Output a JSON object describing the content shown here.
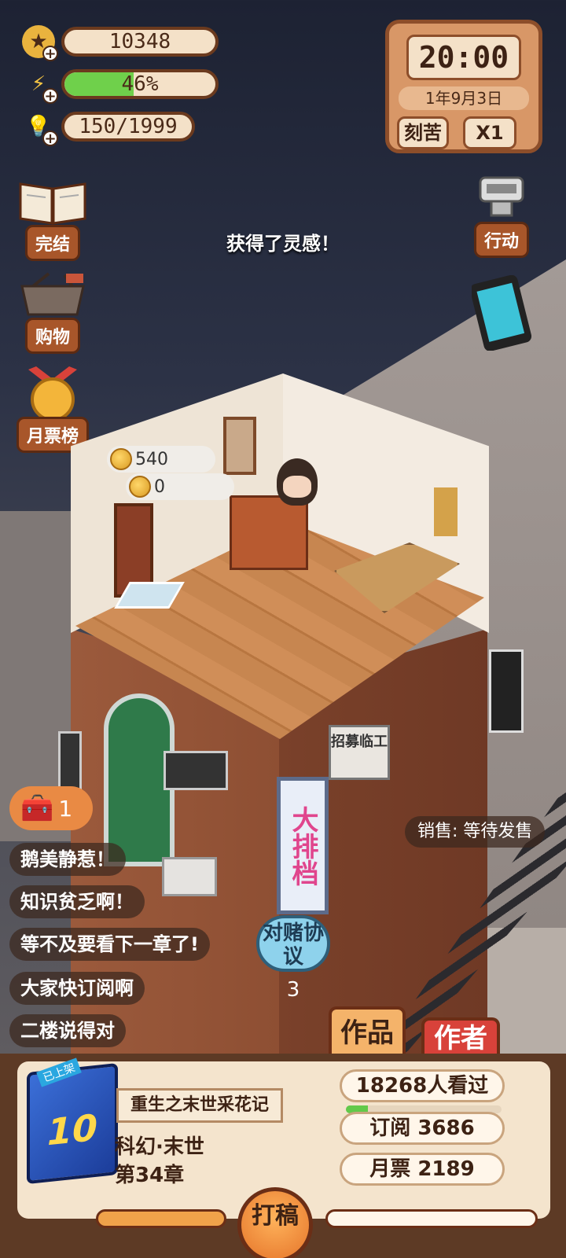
{
  "resources": {
    "coins": "10348",
    "energy_percent": 46,
    "energy_text": "46%",
    "inspiration": "150/1999"
  },
  "clock": {
    "time": "20:00",
    "date": "1年9月3日",
    "mode_button": "刻苦",
    "speed_button": "X1"
  },
  "left_menu": [
    {
      "label": "完结",
      "icon": "open-book-icon"
    },
    {
      "label": "购物",
      "icon": "shopping-basket-icon"
    },
    {
      "label": "月票榜",
      "icon": "medal-icon"
    }
  ],
  "right_menu": {
    "action_label": "行动",
    "action_icon": "typewriter-icon",
    "phone_icon": "phone-icon"
  },
  "toast": "获得了灵感！",
  "room": {
    "bubble_1": "540",
    "bubble_2": "0"
  },
  "signs": {
    "big_sign": "大排档",
    "recruit": "招募临工"
  },
  "chest_count": "1",
  "comments": [
    "鹅美静惹！",
    "知识贫乏啊！",
    "等不及要看下一章了!",
    "大家快订阅啊",
    "二楼说得对"
  ],
  "sales_status": "销售: 等待发售",
  "gamble": {
    "label": "对赌协议",
    "count": "3"
  },
  "tabs": {
    "works": "作品",
    "author": "作者"
  },
  "novel": {
    "cover_number": "10",
    "cover_tag": "已上架",
    "title": "重生之末世采花记",
    "genre": "科幻·末世",
    "chapter": "第34章",
    "views": "18268人看过",
    "views_progress": 0.14,
    "subscriptions": "订阅 3686",
    "monthly_tickets": "月票 2189"
  },
  "write_button": "打稿",
  "colors": {
    "accent_brown": "#a8562a",
    "energy_green": "#6fd04b",
    "author_tab_red": "#d8423a",
    "works_tab_orange": "#f4b36a"
  }
}
